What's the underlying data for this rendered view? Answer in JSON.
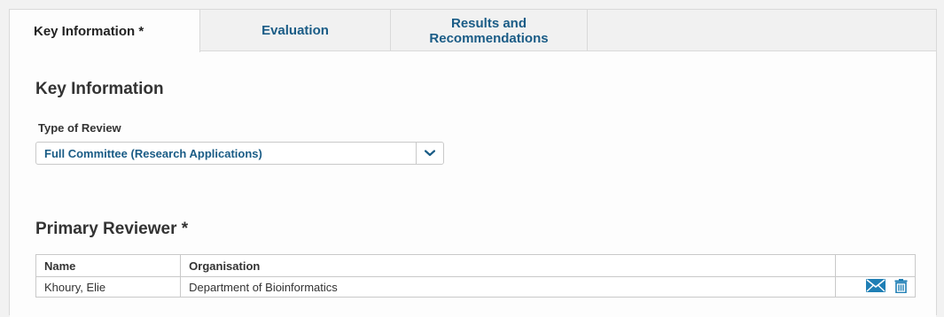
{
  "tabs": [
    {
      "label": "Key Information *",
      "active": true
    },
    {
      "label": "Evaluation",
      "active": false
    },
    {
      "label": "Results and Recommendations",
      "active": false
    }
  ],
  "section_title": "Key Information",
  "review_type": {
    "label": "Type of Review",
    "selected": "Full Committee (Research Applications)"
  },
  "primary_reviewer": {
    "title": "Primary Reviewer *",
    "columns": [
      "Name",
      "Organisation",
      ""
    ],
    "rows": [
      {
        "name": "Khoury, Elie",
        "organisation": "Department of Bioinformatics"
      }
    ],
    "icons": [
      "email-icon",
      "trash-icon"
    ]
  },
  "colors": {
    "accent": "#1a5c86",
    "icon": "#1f7fb5"
  }
}
